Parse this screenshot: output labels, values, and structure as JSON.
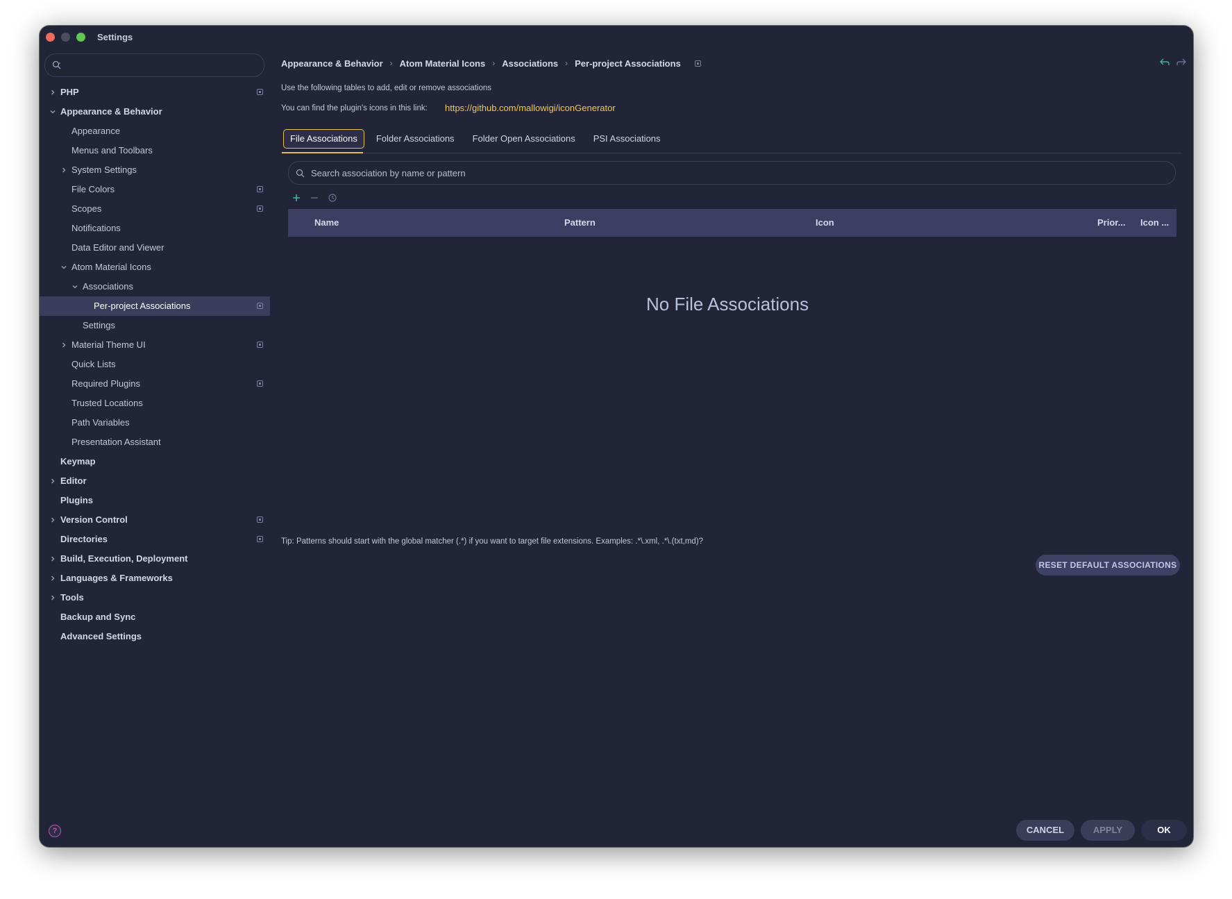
{
  "window": {
    "title": "Settings"
  },
  "sidebar": {
    "search_placeholder": "",
    "tree": [
      {
        "label": "PHP",
        "bold": true,
        "level": 0,
        "arrow": "right",
        "proj": true
      },
      {
        "label": "Appearance & Behavior",
        "bold": true,
        "level": 0,
        "arrow": "down",
        "proj": false
      },
      {
        "label": "Appearance",
        "bold": false,
        "level": 1,
        "arrow": "",
        "proj": false
      },
      {
        "label": "Menus and Toolbars",
        "bold": false,
        "level": 1,
        "arrow": "",
        "proj": false
      },
      {
        "label": "System Settings",
        "bold": false,
        "level": 1,
        "arrow": "right",
        "proj": false
      },
      {
        "label": "File Colors",
        "bold": false,
        "level": 1,
        "arrow": "",
        "proj": true
      },
      {
        "label": "Scopes",
        "bold": false,
        "level": 1,
        "arrow": "",
        "proj": true
      },
      {
        "label": "Notifications",
        "bold": false,
        "level": 1,
        "arrow": "",
        "proj": false
      },
      {
        "label": "Data Editor and Viewer",
        "bold": false,
        "level": 1,
        "arrow": "",
        "proj": false
      },
      {
        "label": "Atom Material Icons",
        "bold": false,
        "level": 1,
        "arrow": "down",
        "proj": false
      },
      {
        "label": "Associations",
        "bold": false,
        "level": 2,
        "arrow": "down",
        "proj": false
      },
      {
        "label": "Per-project Associations",
        "bold": false,
        "level": 3,
        "arrow": "",
        "proj": true,
        "selected": true
      },
      {
        "label": "Settings",
        "bold": false,
        "level": 2,
        "arrow": "",
        "proj": false
      },
      {
        "label": "Material Theme UI",
        "bold": false,
        "level": 1,
        "arrow": "right",
        "proj": true
      },
      {
        "label": "Quick Lists",
        "bold": false,
        "level": 1,
        "arrow": "",
        "proj": false
      },
      {
        "label": "Required Plugins",
        "bold": false,
        "level": 1,
        "arrow": "",
        "proj": true
      },
      {
        "label": "Trusted Locations",
        "bold": false,
        "level": 1,
        "arrow": "",
        "proj": false
      },
      {
        "label": "Path Variables",
        "bold": false,
        "level": 1,
        "arrow": "",
        "proj": false
      },
      {
        "label": "Presentation Assistant",
        "bold": false,
        "level": 1,
        "arrow": "",
        "proj": false
      },
      {
        "label": "Keymap",
        "bold": true,
        "level": 0,
        "arrow": "",
        "proj": false
      },
      {
        "label": "Editor",
        "bold": true,
        "level": 0,
        "arrow": "right",
        "proj": false
      },
      {
        "label": "Plugins",
        "bold": true,
        "level": 0,
        "arrow": "",
        "proj": false
      },
      {
        "label": "Version Control",
        "bold": true,
        "level": 0,
        "arrow": "right",
        "proj": true
      },
      {
        "label": "Directories",
        "bold": true,
        "level": 0,
        "arrow": "",
        "proj": true
      },
      {
        "label": "Build, Execution, Deployment",
        "bold": true,
        "level": 0,
        "arrow": "right",
        "proj": false
      },
      {
        "label": "Languages & Frameworks",
        "bold": true,
        "level": 0,
        "arrow": "right",
        "proj": false
      },
      {
        "label": "Tools",
        "bold": true,
        "level": 0,
        "arrow": "right",
        "proj": false
      },
      {
        "label": "Backup and Sync",
        "bold": true,
        "level": 0,
        "arrow": "",
        "proj": false
      },
      {
        "label": "Advanced Settings",
        "bold": true,
        "level": 0,
        "arrow": "",
        "proj": false
      }
    ]
  },
  "breadcrumb": [
    "Appearance & Behavior",
    "Atom Material Icons",
    "Associations",
    "Per-project Associations"
  ],
  "main": {
    "description": "Use the following tables to add, edit or remove associations",
    "link_prefix": "You can find the plugin's icons in this link:",
    "link": "https://github.com/mallowigi/iconGenerator",
    "tabs": [
      "File Associations",
      "Folder Associations",
      "Folder Open Associations",
      "PSI Associations"
    ],
    "active_tab": 0,
    "search_placeholder": "Search association by name or pattern",
    "columns": {
      "name": "Name",
      "pattern": "Pattern",
      "icon": "Icon",
      "priority": "Prior...",
      "icon_color": "Icon ..."
    },
    "empty_text": "No File Associations",
    "tip": "Tip: Patterns should start with the global matcher (.*) if you want to target file extensions. Examples: .*\\.xml, .*\\.(txt,md)?",
    "reset_label": "RESET DEFAULT ASSOCIATIONS"
  },
  "footer": {
    "cancel": "CANCEL",
    "apply": "APPLY",
    "ok": "OK",
    "help": "?"
  },
  "colors": {
    "background": "#222538",
    "accent": "#e6c24a",
    "selection": "#3a3e5c",
    "header": "#3b3f61",
    "add": "#3fb3a8"
  }
}
